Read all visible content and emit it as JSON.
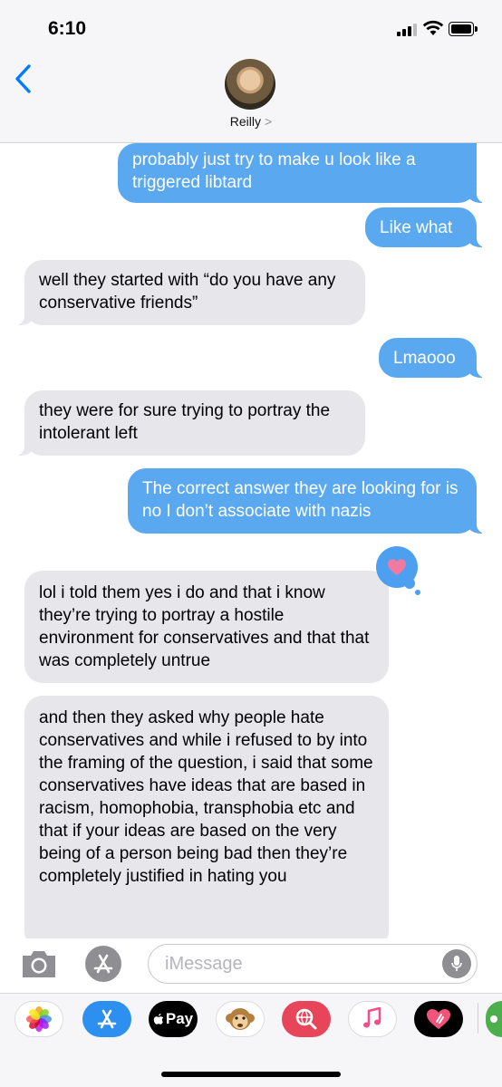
{
  "status_bar": {
    "time": "6:10"
  },
  "header": {
    "contact_name": "Reilly",
    "chevron": ">"
  },
  "messages": [
    {
      "side": "sent",
      "text": "probably just try to make u look like a triggered libtard"
    },
    {
      "side": "sent",
      "text": "Like what"
    },
    {
      "side": "received",
      "text": "well they started with “do you have any conservative friends”"
    },
    {
      "side": "sent",
      "text": "Lmaooo"
    },
    {
      "side": "received",
      "text": "they were for sure trying to portray the intolerant left"
    },
    {
      "side": "sent",
      "text": "The correct answer they are looking for is no I don’t associate with nazis"
    },
    {
      "side": "received",
      "text": "lol i told them yes i do and that i know they’re trying to portray a hostile environment for conservatives and that that was completely untrue",
      "tapback": "heart-icon"
    },
    {
      "side": "received",
      "text": "and then they asked why people hate conservatives and while i refused to by into the framing of the question, i said that some conservatives have ideas that are based in racism, homophobia, transphobia etc and that if your ideas are based on the very being of a person being bad then they’re completely justified in hating you"
    }
  ],
  "input_bar": {
    "placeholder": "iMessage",
    "value": ""
  },
  "app_drawer": {
    "apps": [
      "photos-icon",
      "app-store-icon",
      "apple-pay-icon",
      "animoji-icon",
      "web-images-icon",
      "music-icon",
      "digital-touch-icon",
      "partial-app-icon"
    ],
    "apple_pay_label": "Pay"
  },
  "colors": {
    "sent": "#5aa9f0",
    "received": "#e6e6eb",
    "accent": "#007aff"
  }
}
